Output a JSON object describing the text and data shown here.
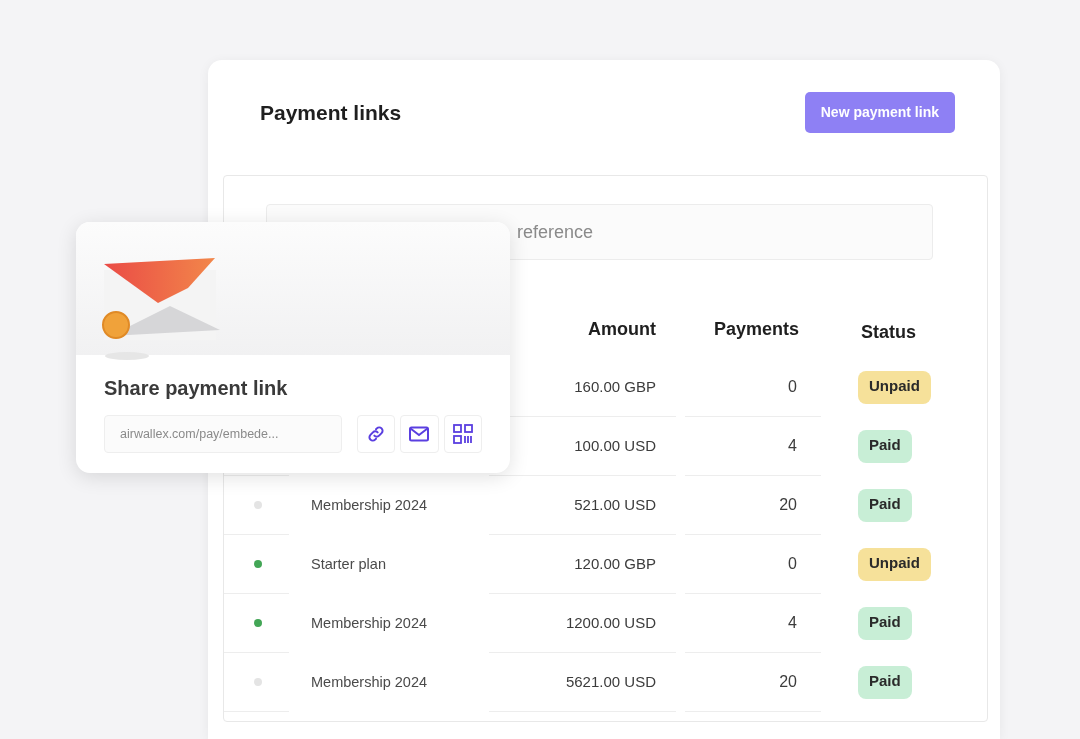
{
  "page": {
    "title": "Payment links",
    "new_button": "New payment link"
  },
  "search": {
    "placeholder": "reference"
  },
  "table": {
    "columns": [
      "Amount",
      "Payments",
      "Status"
    ],
    "rows": [
      {
        "amount": "160.00 GBP",
        "payments": "0",
        "status": {
          "label": "Unpaid",
          "kind": "unpaid"
        }
      },
      {
        "amount": "100.00 USD",
        "payments": "4",
        "status": {
          "label": "Paid",
          "kind": "paid"
        }
      },
      {
        "color": "#e4e4e4",
        "name": "Membership 2024",
        "amount": "521.00 USD",
        "payments": "20",
        "status": {
          "label": "Paid",
          "kind": "paid"
        }
      },
      {
        "color": "#43a656",
        "name": "Starter plan",
        "amount": "120.00 GBP",
        "payments": "0",
        "status": {
          "label": "Unpaid",
          "kind": "unpaid"
        }
      },
      {
        "color": "#43a656",
        "name": "Membership 2024",
        "amount": "1200.00 USD",
        "payments": "4",
        "status": {
          "label": "Paid",
          "kind": "paid"
        }
      },
      {
        "color": "#e4e4e4",
        "name": "Membership 2024",
        "amount": "5621.00 USD",
        "payments": "20",
        "status": {
          "label": "Paid",
          "kind": "paid"
        }
      }
    ]
  },
  "share_card": {
    "title": "Share payment link",
    "link": "airwallex.com/pay/embede..."
  }
}
